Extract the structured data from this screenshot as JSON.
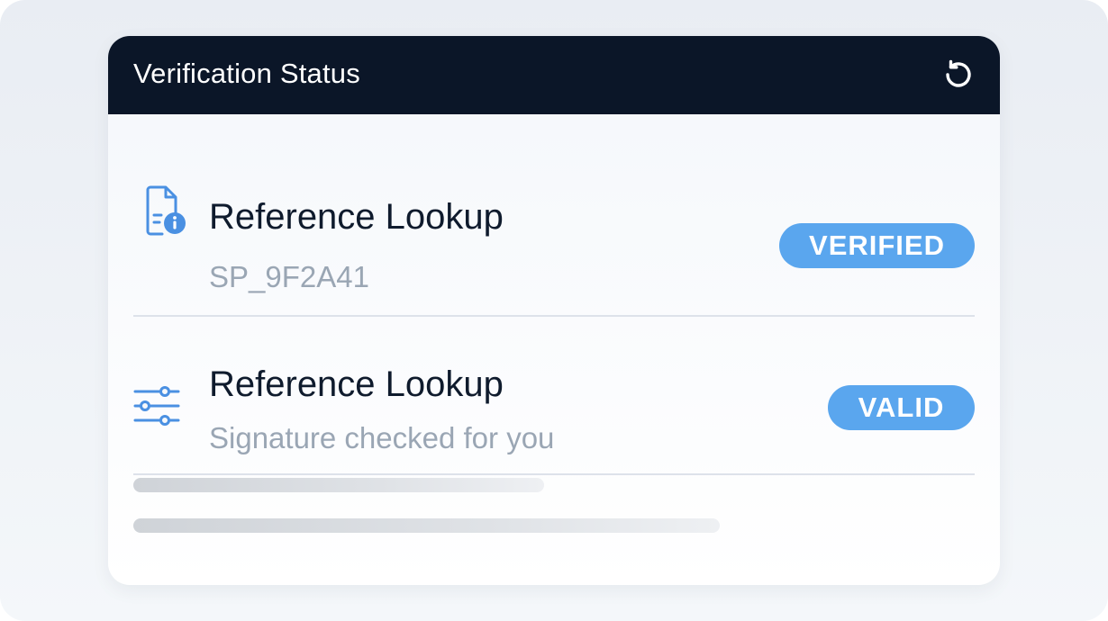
{
  "header": {
    "title": "Verification Status",
    "refresh_icon": "refresh-icon"
  },
  "items": [
    {
      "title": "Reference Lookup",
      "subtitle": "SP_9F2A41",
      "badge": "VERIFIED",
      "icon": "document-info-icon"
    },
    {
      "title": "Reference Lookup",
      "subtitle": "Signature checked for you",
      "badge": "VALID",
      "icon": "sliders-icon"
    }
  ],
  "colors": {
    "header_bg": "#0b1628",
    "badge_bg": "#5aa6ee",
    "icon_blue": "#4a90e2",
    "title_text": "#0f1b2d",
    "subtitle_text": "#9aa6b4"
  }
}
